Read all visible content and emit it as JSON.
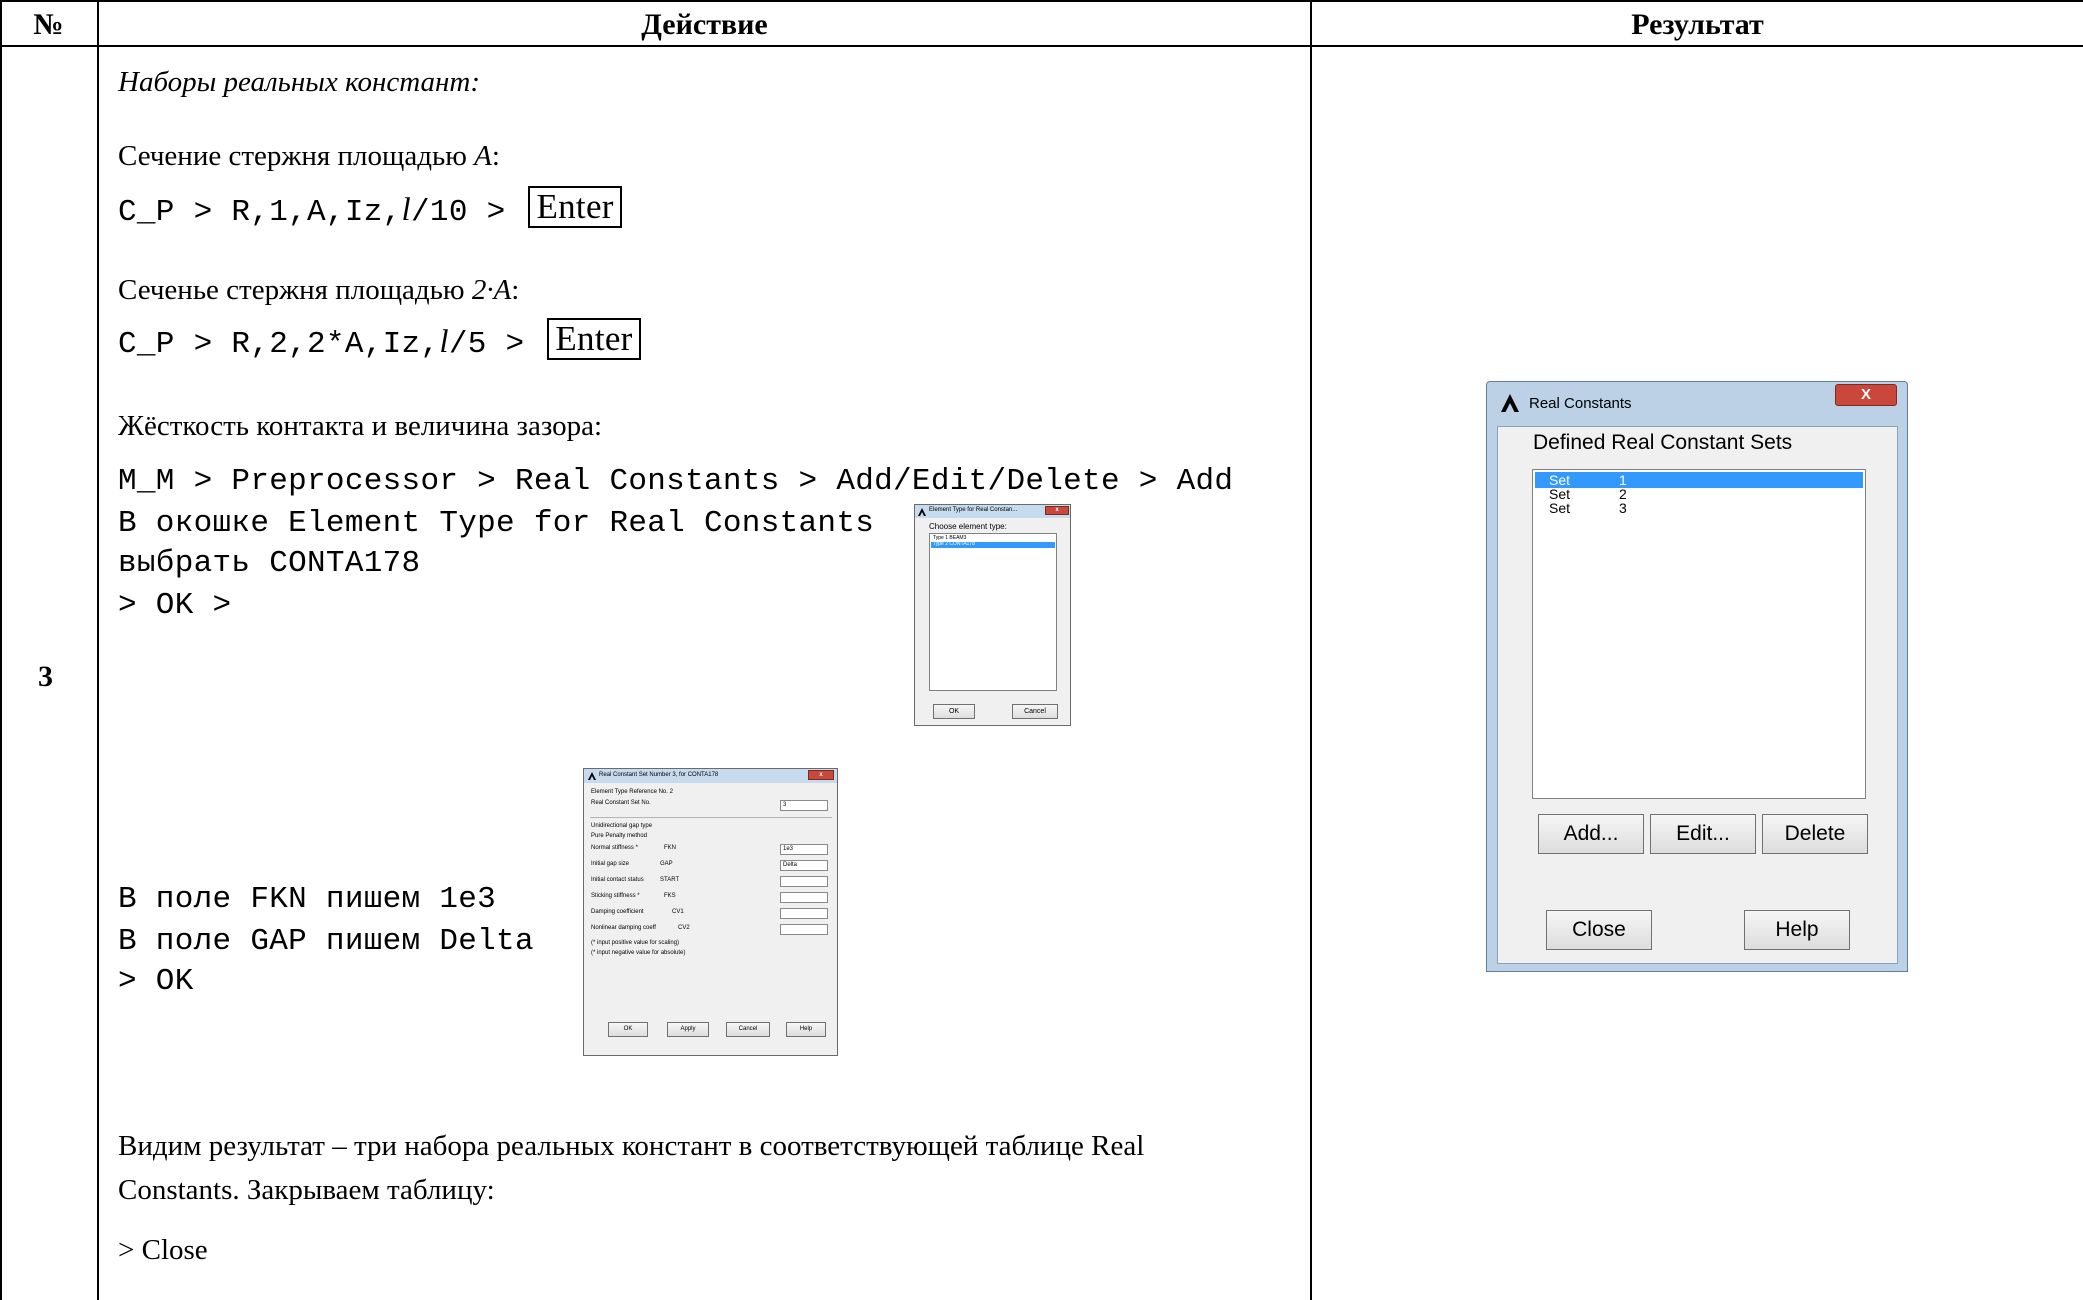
{
  "table": {
    "header_num": "№",
    "header_action": "Действие",
    "header_result": "Результат",
    "row_number": "3"
  },
  "action": {
    "heading": "Наборы реальных констант:",
    "sec1_label_pre": "Сечение стержня площадью ",
    "sec1_label_var": "A",
    "sec1_label_post": ":",
    "cmd1_pre": "C_P > R,1,A,Iz,",
    "cmd1_ell": "l",
    "cmd1_post": "/10 > ",
    "enter_key": "Enter",
    "sec2_label_pre": "Сеченье стержня площадью ",
    "sec2_label_var": "2·A",
    "sec2_label_post": ":",
    "cmd2_pre": "C_P > R,2,2*A,Iz,",
    "cmd2_ell": "l",
    "cmd2_post": "/5 > ",
    "contact_label": "Жёсткость контакта и величина зазора:",
    "path_line": "M_M > Preprocessor > Real Constants > Add/Edit/Delete > Add",
    "step1_line1": "В окошке Element Type for Real Constants",
    "step1_line2": "выбрать CONTA178",
    "step1_line3": "> OK >",
    "step2_line1": "В поле FKN пишем 1e3",
    "step2_line2": "В поле GAP пишем Delta",
    "step2_line3": "> OK",
    "result_text_line1": "Видим результат – три набора реальных констант в соответствующей таблице Real",
    "result_text_line2": "Constants. Закрываем таблицу:",
    "close_line": "> Close"
  },
  "dialog_element_type": {
    "title": "Element Type for Real Constan...",
    "prompt": "Choose element type:",
    "rows": [
      "Type  1   BEAM3",
      "Type  2   CONTA178"
    ],
    "ok": "OK",
    "cancel": "Cancel"
  },
  "dialog_real_set": {
    "title": "Real Constant Set Number 3, for CONTA178",
    "element_type_ref": "Element Type Reference No. 2",
    "set_no_label": "Real Constant Set No.",
    "set_no_value": "3",
    "gap_type": "Unidirectional gap type",
    "method": "Pure Penalty method",
    "fields": [
      {
        "label": "Normal stiffness *",
        "code": "FKN",
        "value": "1e3"
      },
      {
        "label": "Initial gap size",
        "code": "GAP",
        "value": "Delta"
      },
      {
        "label": "Initial contact status",
        "code": "START",
        "value": ""
      },
      {
        "label": "Sticking stiffness *",
        "code": "FKS",
        "value": ""
      },
      {
        "label": "Damping coefficient",
        "code": "CV1",
        "value": ""
      },
      {
        "label": "Nonlinear damping coeff",
        "code": "CV2",
        "value": ""
      }
    ],
    "note1": "(* input positive value for scaling)",
    "note2": "(* input negative value for absolute)",
    "ok": "OK",
    "apply": "Apply",
    "cancel": "Cancel",
    "help": "Help"
  },
  "dialog_real_constants": {
    "title": "Real Constants",
    "close_x": "X",
    "heading": "Defined Real Constant Sets",
    "sets": [
      {
        "label": "Set",
        "num": "1",
        "selected": true
      },
      {
        "label": "Set",
        "num": "2",
        "selected": false
      },
      {
        "label": "Set",
        "num": "3",
        "selected": false
      }
    ],
    "add": "Add...",
    "edit": "Edit...",
    "delete": "Delete",
    "close": "Close",
    "help": "Help"
  }
}
